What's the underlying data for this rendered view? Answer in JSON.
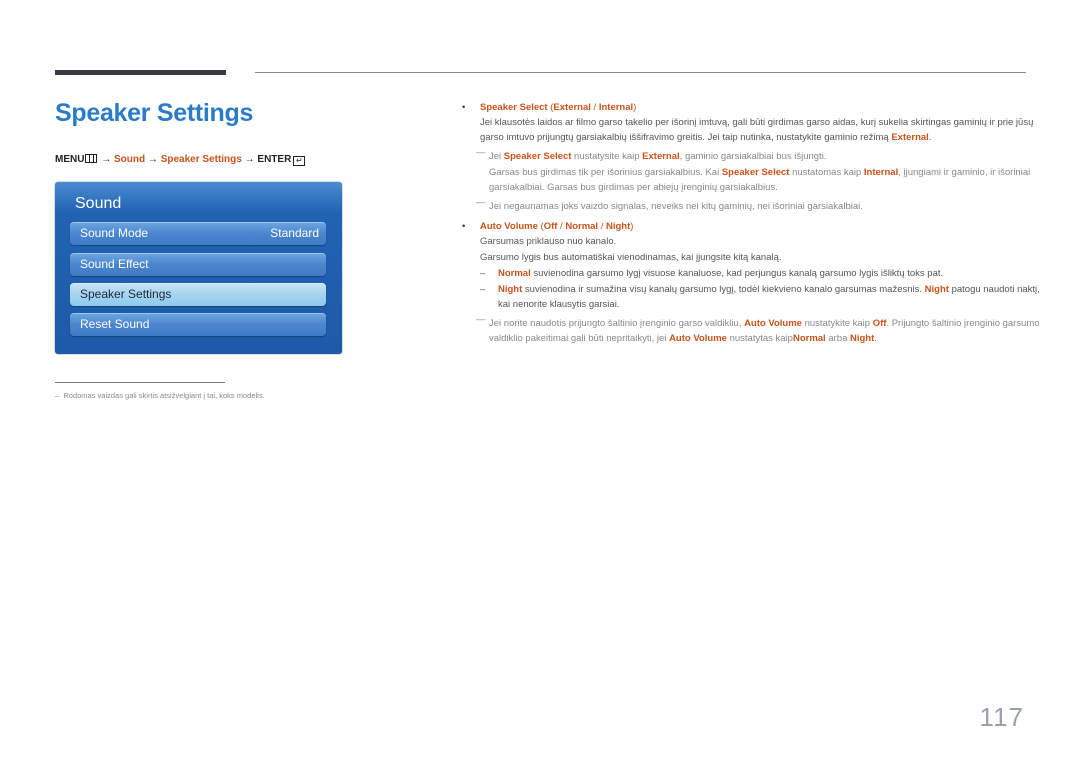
{
  "page": {
    "title": "Speaker Settings",
    "page_number": "117",
    "accent_color": "#2a7bc8",
    "highlight_color": "#c9531b"
  },
  "menu_path": {
    "menu": "MENU",
    "arrow": "→",
    "sound": "Sound",
    "speaker_settings": "Speaker Settings",
    "enter": "ENTER",
    "enter_glyph": "↵"
  },
  "osd": {
    "title": "Sound",
    "items": [
      {
        "label": "Sound Mode",
        "value": "Standard"
      },
      {
        "label": "Sound Effect",
        "value": ""
      },
      {
        "label": "Speaker Settings",
        "value": "",
        "selected": true
      },
      {
        "label": "Reset Sound",
        "value": ""
      }
    ]
  },
  "footnote": {
    "dash": "–",
    "text": "Rodomas vaizdas gali skirtis atsižvelgiant į tai, koks modelis."
  },
  "speaker_select": {
    "bullet": "•",
    "name": "Speaker Select",
    "open": " (",
    "opt1": "External",
    "sep": " / ",
    "opt2": "Internal",
    "close": ")",
    "desc1": "Jei klausotės laidos ar filmo garso takelio per išorinį imtuvą, gali būti girdimas garso aidas, kurį sukelia skirtingas gaminių ir prie jūsų garso imtuvo prijungtų garsiakalbių iššifravimo greitis. Jei taip nutinka, nustatykite gaminio režimą ",
    "desc1_hl": "External",
    "desc1_end": ".",
    "note1": {
      "dash": "―",
      "t1": "Jei ",
      "h1": "Speaker Select",
      "t2": " nustatysite kaip ",
      "h2": "External",
      "t3": ", gaminio garsiakalbiai bus išjungti."
    },
    "note1_cont": {
      "t1": "Garsas bus girdimas tik per išorinius garsiakalbius. Kai ",
      "h1": "Speaker Select",
      "t2": " nustatomas kaip ",
      "h2": "Internal",
      "t3": ", įjungiami ir gaminio, ir išoriniai garsiakalbiai. Garsas bus girdimas per abiejų įrenginių garsiakalbius."
    },
    "note2": {
      "dash": "―",
      "text": "Jei negaunamas joks vaizdo signalas, neveiks nei kitų gaminių, nei išoriniai garsiakalbiai."
    }
  },
  "auto_volume": {
    "bullet": "•",
    "name": "Auto Volume",
    "open": " (",
    "opt1": "Off",
    "sep1": " / ",
    "opt2": "Normal",
    "sep2": " / ",
    "opt3": "Night",
    "close": ")",
    "desc1": "Garsumas priklauso nuo kanalo.",
    "desc2": "Garsumo lygis bus automatiškai vienodinamas, kai įjungsite kitą kanalą.",
    "sub1": {
      "dash": "–",
      "h1": "Normal",
      "t1": " suvienodina garsumo lygį visuose kanaluose, kad perjungus kanalą garsumo lygis išliktų toks pat."
    },
    "sub2": {
      "dash": "–",
      "h1": "Night",
      "t1": " suvienodina ir sumažina visų kanalų garsumo lygį, todėl kiekvieno kanalo garsumas mažesnis. ",
      "h2": "Night",
      "t2": " patogu naudoti naktį, kai nenorite klausytis garsiai."
    },
    "note": {
      "dash": "―",
      "t1": "Jei norite naudotis prijungto šaltinio įrenginio garso valdikliu, ",
      "h1": "Auto Volume",
      "t2": " nustatykite kaip ",
      "h2": "Off",
      "t3": ". Prijungto šaltinio įrenginio garsumo valdiklio pakeitimai gali būti nepritaikyti, jei ",
      "h3": "Auto Volume",
      "t4": " nustatytas kaip",
      "h4": "Normal",
      "t5": " arba ",
      "h5": "Night",
      "t6": "."
    }
  }
}
